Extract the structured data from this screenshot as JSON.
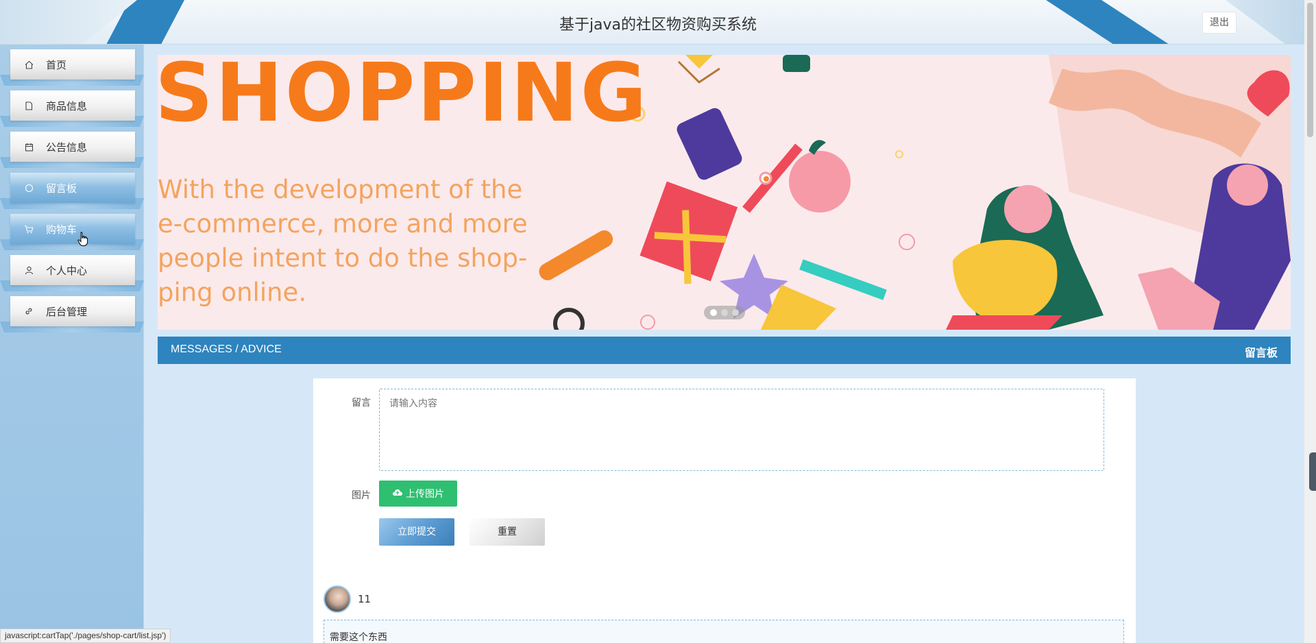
{
  "header": {
    "title": "基于java的社区物资购买系统",
    "logout_label": "退出"
  },
  "sidebar": {
    "items": [
      {
        "label": "首页",
        "icon": "home-icon"
      },
      {
        "label": "商品信息",
        "icon": "document-icon"
      },
      {
        "label": "公告信息",
        "icon": "calendar-icon"
      },
      {
        "label": "留言板",
        "icon": "chat-icon"
      },
      {
        "label": "购物车",
        "icon": "cart-icon"
      },
      {
        "label": "个人中心",
        "icon": "user-icon"
      },
      {
        "label": "后台管理",
        "icon": "link-icon"
      }
    ]
  },
  "banner": {
    "heading": "SHOPPING",
    "tagline_lines": [
      "With the development of the",
      "e-commerce, more and more",
      "people intent to do the shop-",
      "ping online."
    ],
    "slide_count": 3,
    "active_slide": 1
  },
  "section_bar": {
    "left": "MESSAGES / ADVICE",
    "right": "留言板"
  },
  "form": {
    "message_label": "留言",
    "message_placeholder": "请输入内容",
    "message_value": "",
    "image_label": "图片",
    "upload_label": "上传图片",
    "submit_label": "立即提交",
    "reset_label": "重置"
  },
  "comments": [
    {
      "username": "11",
      "content": "需要这个东西"
    }
  ],
  "status_bar": {
    "text": "javascript:cartTap('./pages/shop-cart/list.jsp')"
  },
  "colors": {
    "accent_blue": "#2e84be",
    "upload_green": "#2fbf71",
    "banner_orange": "#f67a1a"
  }
}
